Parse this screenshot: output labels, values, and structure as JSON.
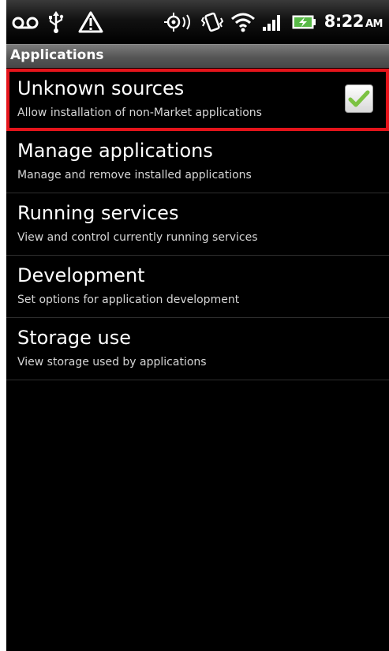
{
  "status_bar": {
    "time": "8:22",
    "ampm": "AM",
    "icons": [
      "voicemail-icon",
      "usb-icon",
      "warning-icon",
      "gps-icon",
      "vibrate-icon",
      "wifi-icon",
      "signal-icon",
      "battery-charging-icon"
    ]
  },
  "header": {
    "title": "Applications"
  },
  "settings": {
    "items": [
      {
        "title": "Unknown sources",
        "summary": "Allow installation of non-Market applications",
        "checked": true
      },
      {
        "title": "Manage applications",
        "summary": "Manage and remove installed applications"
      },
      {
        "title": "Running services",
        "summary": "View and control currently running services"
      },
      {
        "title": "Development",
        "summary": "Set options for application development"
      },
      {
        "title": "Storage use",
        "summary": "View storage used by applications"
      }
    ]
  },
  "colors": {
    "highlight_border": "#e5141b",
    "check_green": "#7cc242",
    "background": "#000000"
  }
}
